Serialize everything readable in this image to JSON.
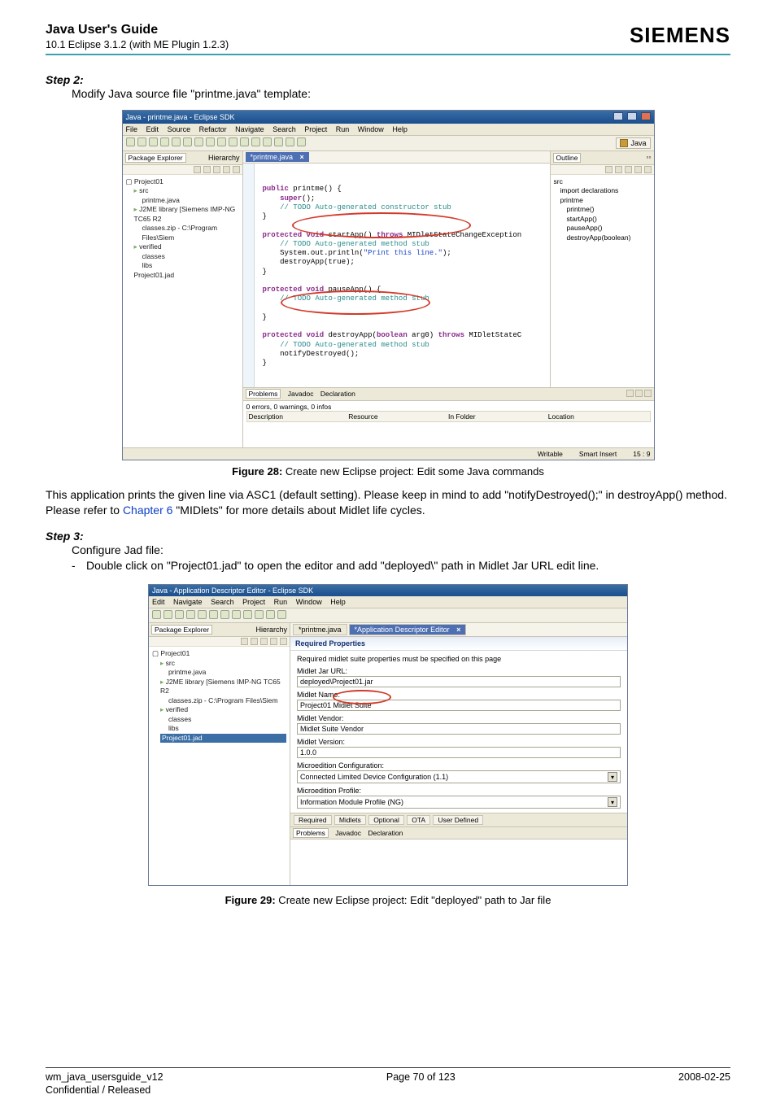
{
  "header": {
    "title": "Java User's Guide",
    "subtitle": "10.1 Eclipse 3.1.2 (with ME Plugin 1.2.3)",
    "brand": "SIEMENS"
  },
  "step2": {
    "label": "Step 2:",
    "text": "Modify Java source file \"printme.java\" template:"
  },
  "fig28": {
    "caption_label": "Figure 28:",
    "caption_text": "  Create new Eclipse project: Edit some Java commands"
  },
  "para1_a": "This application prints the given line via ASC1 (default setting). Please keep in mind to add \"notifyDestroyed();\" in destroyApp() method. Please refer to ",
  "para1_link": "Chapter 6",
  "para1_b": " \"MIDlets\" for more details about Midlet life cycles.",
  "step3": {
    "label": "Step 3:",
    "line1": "Configure Jad file:",
    "bullet": "-",
    "line2": "Double click on \"Project01.jad\" to open the editor and add \"deployed\\\" path in Midlet Jar URL edit line."
  },
  "fig29": {
    "caption_label": "Figure 29:",
    "caption_text": "  Create new Eclipse project: Edit \"deployed\" path to Jar file"
  },
  "footer": {
    "left": "wm_java_usersguide_v12",
    "center": "Page 70 of 123",
    "right": "2008-02-25",
    "sub": "Confidential / Released"
  },
  "shot1": {
    "title": "Java - printme.java - Eclipse SDK",
    "menus": [
      "File",
      "Edit",
      "Source",
      "Refactor",
      "Navigate",
      "Search",
      "Project",
      "Run",
      "Window",
      "Help"
    ],
    "perspective": "Java",
    "pkg_tab": "Package Explorer",
    "hier_tab": "Hierarchy",
    "tree": {
      "project": "Project01",
      "src": "src",
      "file": "printme.java",
      "j2me": "J2ME library [Siemens IMP-NG TC65 R2",
      "classes": "classes.zip - C:\\Program Files\\Siem",
      "verified": "verified",
      "classes2": "classes",
      "libs": "libs",
      "jad": "Project01.jad"
    },
    "editor_tab": "*printme.java",
    "code": {
      "l1a": "public",
      "l1b": " printme() {",
      "l2a": "super",
      "l2b": "();",
      "l3": "// TODO Auto-generated constructor stub",
      "l4": "}",
      "l5a": "protected void",
      "l5b": " startApp() ",
      "l5c": "throws",
      "l5d": " MIDletStateChangeException",
      "l6": "// TODO Auto-generated method stub",
      "l7a": "System.out.println(",
      "l7b": "\"Print this line.\"",
      "l7c": ");",
      "l8": "destroyApp(true);",
      "l9": "}",
      "l10a": "protected void",
      "l10b": " pauseApp() {",
      "l11": "// TODO Auto-generated method stub",
      "l12": "}",
      "l13a": "protected void",
      "l13b": " destroyApp(",
      "l13c": "boolean",
      "l13d": " arg0) ",
      "l13e": "throws",
      "l13f": " MIDletStateC",
      "l14": "// TODO Auto-generated method stub",
      "l15": "notifyDestroyed();",
      "l16": "}"
    },
    "outline_tab": "Outline",
    "outline": {
      "i0": "src",
      "i1": "import declarations",
      "i2": "printme",
      "i3": "printme()",
      "i4": "startApp()",
      "i5": "pauseApp()",
      "i6": "destroyApp(boolean)"
    },
    "problems": {
      "tab1": "Problems",
      "tab2": "Javadoc",
      "tab3": "Declaration",
      "summary": "0 errors, 0 warnings, 0 infos",
      "c1": "Description",
      "c2": "Resource",
      "c3": "In Folder",
      "c4": "Location"
    },
    "status": {
      "s1": "Writable",
      "s2": "Smart Insert",
      "s3": "15 : 9"
    }
  },
  "shot2": {
    "title": "Java - Application Descriptor Editor - Eclipse SDK",
    "menus": [
      "Edit",
      "Navigate",
      "Search",
      "Project",
      "Run",
      "Window",
      "Help"
    ],
    "pkg_tab": "Package Explorer",
    "hier_tab": "Hierarchy",
    "tree": {
      "project": "Project01",
      "src": "src",
      "file": "printme.java",
      "j2me": "J2ME library [Siemens IMP-NG TC65 R2",
      "classes": "classes.zip - C:\\Program Files\\Siem",
      "verified": "verified",
      "classes2": "classes",
      "libs": "libs",
      "jad": "Project01.jad"
    },
    "ed_tab1": "*printme.java",
    "ed_tab2": "*Application Descriptor Editor",
    "form_header": "Required Properties",
    "note": "Required midlet suite properties must be specified on this page",
    "f1_l": "Midlet Jar URL:",
    "f1_v": "deployed\\Project01.jar",
    "f2_l": "Midlet Name:",
    "f2_v": "Project01 Midlet Suite",
    "f3_l": "Midlet Vendor:",
    "f3_v": "Midlet Suite Vendor",
    "f4_l": "Midlet Version:",
    "f4_v": "1.0.0",
    "f5_l": "Microedition Configuration:",
    "f5_v": "Connected Limited Device Configuration (1.1)",
    "f6_l": "Microedition Profile:",
    "f6_v": "Information Module Profile (NG)",
    "bottom_tabs": [
      "Required",
      "Midlets",
      "Optional",
      "OTA",
      "User Defined"
    ],
    "problems": {
      "tab1": "Problems",
      "tab2": "Javadoc",
      "tab3": "Declaration"
    }
  }
}
